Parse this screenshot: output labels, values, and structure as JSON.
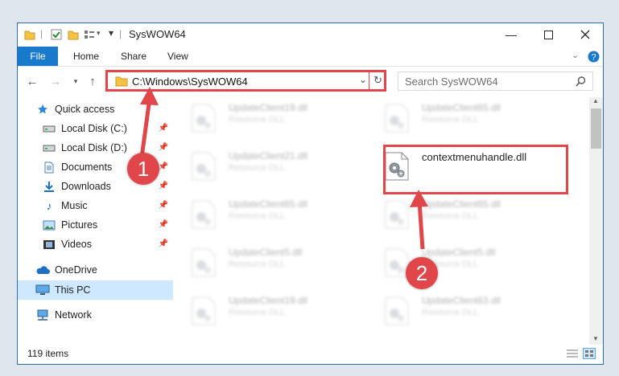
{
  "window": {
    "title": "SysWOW64",
    "controls": [
      "minimize-icon",
      "maximize-icon",
      "close-icon"
    ]
  },
  "ribbon": {
    "file_label": "File",
    "tabs": [
      {
        "label": "Home"
      },
      {
        "label": "Share"
      },
      {
        "label": "View"
      }
    ]
  },
  "address": {
    "path": "C:\\Windows\\SysWOW64",
    "search_placeholder": "Search SysWOW64"
  },
  "sidebar": {
    "items": [
      {
        "label": "Quick access",
        "icon": "star-icon",
        "pinned": false
      },
      {
        "label": "Local Disk (C:)",
        "icon": "drive-icon",
        "pinned": true
      },
      {
        "label": "Local Disk (D:)",
        "icon": "drive-icon",
        "pinned": true
      },
      {
        "label": "Documents",
        "icon": "documents-icon",
        "pinned": true
      },
      {
        "label": "Downloads",
        "icon": "download-icon",
        "pinned": true
      },
      {
        "label": "Music",
        "icon": "music-icon",
        "pinned": true
      },
      {
        "label": "Pictures",
        "icon": "pictures-icon",
        "pinned": true
      },
      {
        "label": "Videos",
        "icon": "videos-icon",
        "pinned": true
      },
      {
        "label": "OneDrive",
        "icon": "cloud-icon",
        "pinned": false
      },
      {
        "label": "This PC",
        "icon": "computer-icon",
        "pinned": false,
        "selected": true
      },
      {
        "label": "Network",
        "icon": "network-icon",
        "pinned": false
      }
    ]
  },
  "files": [
    {
      "name": "UpdateClient19.dll",
      "type": "Resource DLL"
    },
    {
      "name": "UpdateClient65.dll",
      "type": "Resource DLL"
    },
    {
      "name": "UpdateClient21.dll",
      "type": "Resource DLL"
    },
    {
      "name": "contextmenuhandle.dll",
      "type": ""
    },
    {
      "name": "UpdateClient65.dll",
      "type": "Resource DLL"
    },
    {
      "name": "UpdateClient65.dll",
      "type": "Resource DLL"
    },
    {
      "name": "UpdateClient5.dll",
      "type": "Resource DLL"
    },
    {
      "name": "UpdateClient5.dll",
      "type": "Resource DLL"
    },
    {
      "name": "UpdateClient19.dll",
      "type": "Resource DLL"
    },
    {
      "name": "UpdateClient63.dll",
      "type": "Resource DLL"
    }
  ],
  "status": {
    "item_count": "119 items"
  },
  "annotations": {
    "step1": "1",
    "step2": "2"
  },
  "colors": {
    "accent": "#1979ca",
    "highlight": "#e0464a",
    "selection": "#cde8ff"
  }
}
